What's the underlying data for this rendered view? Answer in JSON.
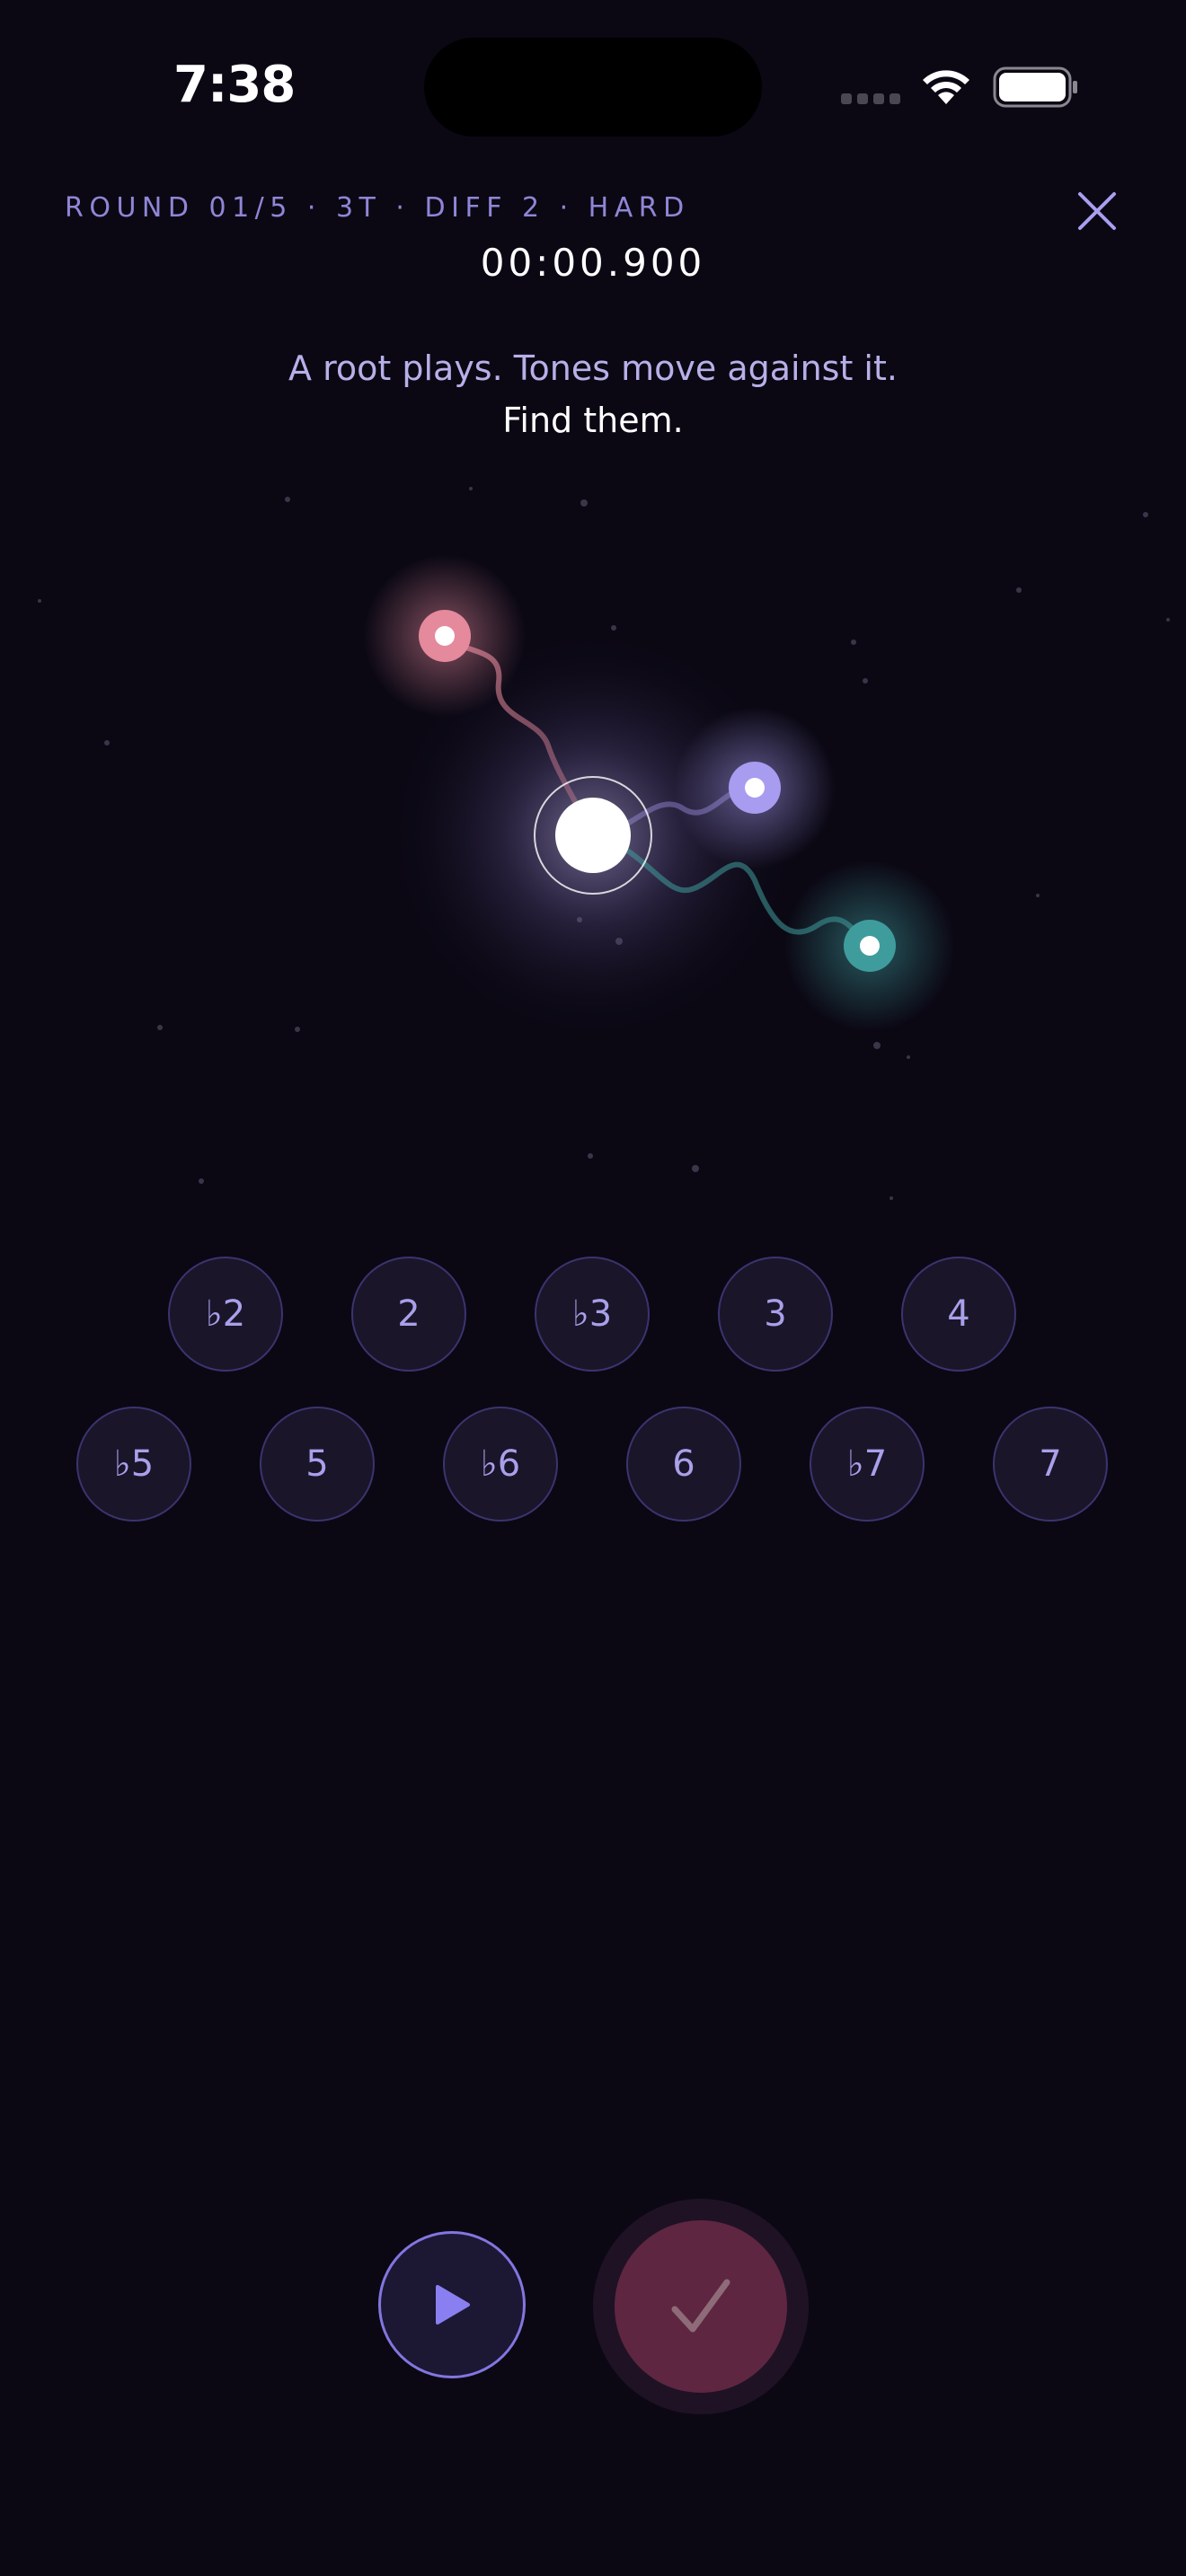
{
  "status_bar": {
    "time": "7:38"
  },
  "header": {
    "round_info": "ROUND 01/5 · 3T · DIFF 2 · HARD",
    "timer": "00:00.900"
  },
  "instruction": {
    "line1": "A root plays. Tones move against it.",
    "line2": "Find them."
  },
  "intervals": {
    "row1": [
      "♭2",
      "2",
      "♭3",
      "3",
      "4"
    ],
    "row2": [
      "♭5",
      "5",
      "♭6",
      "6",
      "♭7",
      "7"
    ]
  },
  "icons": {
    "close": "close-icon",
    "play": "play-icon",
    "submit": "checkmark-icon",
    "wifi": "wifi-icon",
    "battery": "battery-icon"
  },
  "colors": {
    "background": "#0b0814",
    "accent": "#8f86d6",
    "tone_pink": "#e5899c",
    "tone_lavender": "#a79cf0",
    "tone_teal": "#3f9c9c",
    "submit": "#5e2641"
  }
}
